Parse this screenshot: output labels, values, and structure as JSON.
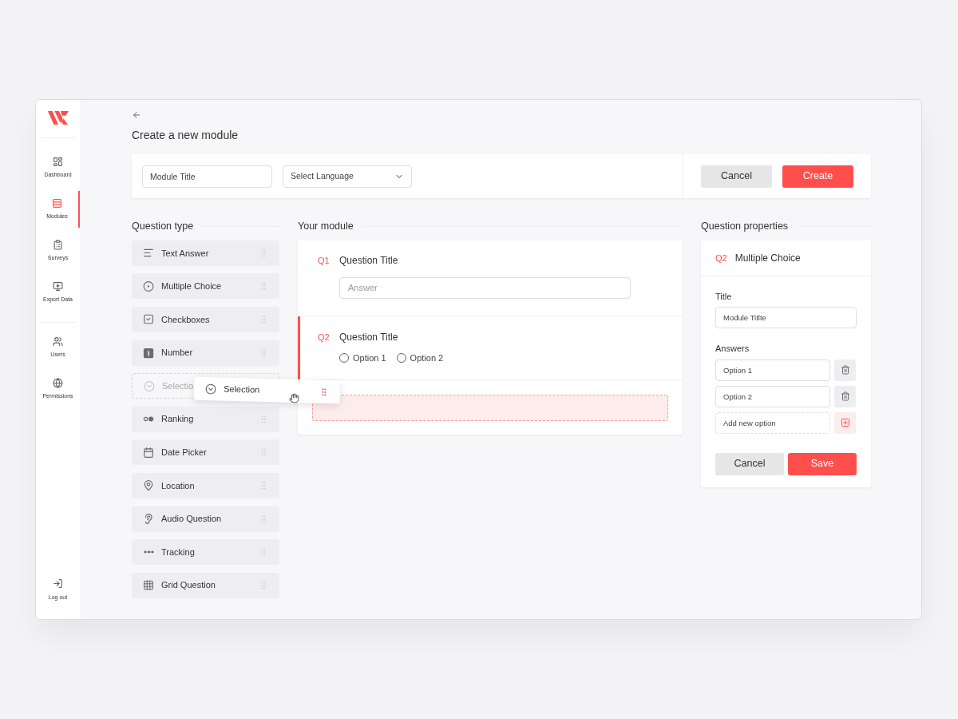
{
  "sidebar": {
    "items": [
      {
        "label": "Dashboard",
        "selected": false
      },
      {
        "label": "Modules",
        "selected": true
      },
      {
        "label": "Surveys",
        "selected": false
      },
      {
        "label": "Export Data",
        "selected": false
      },
      {
        "label": "Users",
        "selected": false
      },
      {
        "label": "Permissions",
        "selected": false
      }
    ],
    "footer_item": {
      "label": "Log out"
    }
  },
  "title": "Create a new module",
  "toolbar": {
    "title_field": {
      "placeholder": "Module Title"
    },
    "language_select": {
      "placeholder": "Select Language"
    },
    "buttons": [
      {
        "label": "Cancel",
        "kind": "secondary"
      },
      {
        "label": "Create",
        "kind": "primary"
      }
    ]
  },
  "question_types": {
    "heading": "Question type",
    "items": [
      {
        "label": "Text Answer",
        "dragging": false
      },
      {
        "label": "Multiple Choice",
        "dragging": false
      },
      {
        "label": "Checkboxes",
        "dragging": false
      },
      {
        "label": "Number",
        "dragging": false
      },
      {
        "label": "Selectio",
        "dragging": true
      },
      {
        "label": "Ranking",
        "dragging": false
      },
      {
        "label": "Date Picker",
        "dragging": false
      },
      {
        "label": "Location",
        "dragging": false
      },
      {
        "label": "Audio Question",
        "dragging": false
      },
      {
        "label": "Tracking",
        "dragging": false
      },
      {
        "label": "Grid Question",
        "dragging": false
      }
    ]
  },
  "drag_preview": {
    "label": "Selection"
  },
  "module": {
    "heading": "Your module",
    "questions": [
      {
        "number": "Q1",
        "title": "Question Title",
        "selected": false,
        "kind": "text",
        "answer_placeholder": "Answer"
      },
      {
        "number": "Q2",
        "title": "Question Title",
        "selected": true,
        "kind": "choice",
        "options": [
          {
            "label": "Option 1",
            "selected": false
          },
          {
            "label": "Option 2",
            "selected": false
          }
        ]
      }
    ]
  },
  "properties": {
    "heading": "Question properties",
    "number": "Q2",
    "type": "Multiple Choice",
    "title_label": "Title",
    "title_value": "Module Titlte",
    "answers_label": "Answers",
    "answers": [
      {
        "value": "Option 1"
      },
      {
        "value": "Option 2"
      }
    ],
    "new_answer": {
      "placeholder": "Add new option"
    },
    "buttons": [
      {
        "label": "Cancel",
        "kind": "secondary"
      },
      {
        "label": "Save",
        "kind": "primary"
      }
    ]
  }
}
